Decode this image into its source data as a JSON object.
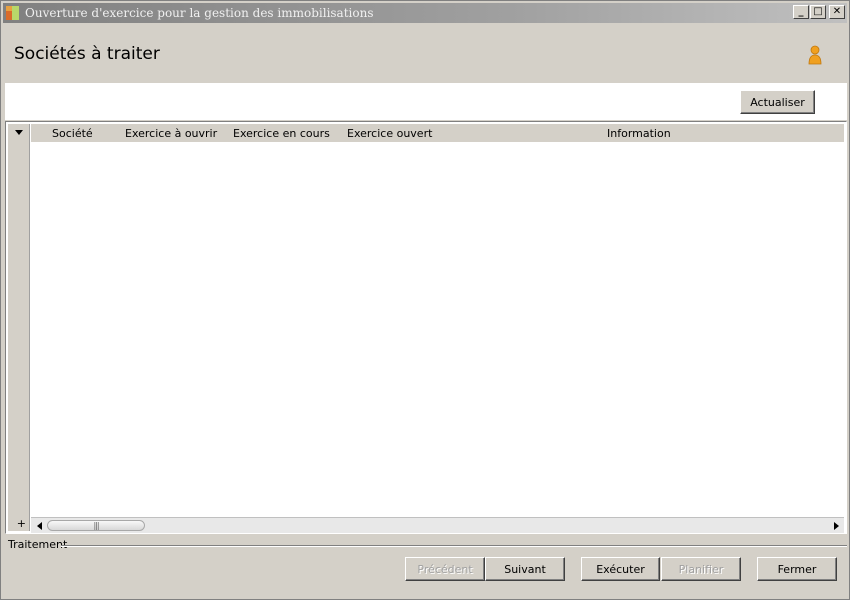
{
  "window": {
    "title": "Ouverture d'exercice pour la gestion des immobilisations",
    "controls": {
      "minimize": "_",
      "maximize": "□",
      "close": "✕"
    }
  },
  "header": {
    "title": "Sociétés à traiter",
    "user_icon": "user-icon"
  },
  "toolbar": {
    "refresh_label": "Actualiser"
  },
  "grid": {
    "columns": [
      "Société",
      "Exercice à ouvrir",
      "Exercice en cours",
      "Exercice ouvert",
      "Information"
    ],
    "rows": [],
    "expand_label": "+",
    "scroll_thumb_grip": "|||"
  },
  "footer": {
    "group_label": "Traitement",
    "buttons": {
      "previous": "Précédent",
      "next": "Suivant",
      "execute": "Exécuter",
      "schedule": "Planifier",
      "close": "Fermer"
    }
  },
  "colors": {
    "background": "#d4d0c8",
    "titlebar": "#808080",
    "content": "#ffffff",
    "user_icon": "#f0a020"
  }
}
